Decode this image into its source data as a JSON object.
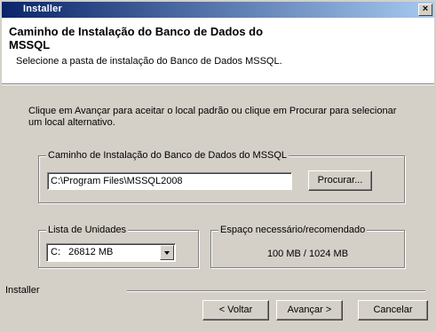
{
  "window": {
    "title": "Installer",
    "close_glyph": "×"
  },
  "header": {
    "title": "Caminho de Instalação do Banco de Dados do MSSQL",
    "subtitle": "Selecione a pasta de instalação do Banco de Dados MSSQL."
  },
  "instruction": "Clique em Avançar para aceitar o local padrão ou clique em Procurar para selecionar um local alternativo.",
  "path_group": {
    "label": "Caminho de Instalação do Banco de Dados do MSSQL",
    "value": "C:\\Program Files\\MSSQL2008",
    "browse_label": "Procurar..."
  },
  "drives_group": {
    "label": "Lista de Unidades",
    "selected": "C:   26812 MB"
  },
  "space_group": {
    "label": "Espaço necessário/recomendado",
    "value": "100 MB / 1024 MB"
  },
  "footer": {
    "label": "Installer",
    "back_label": "< Voltar",
    "next_label": "Avançar >",
    "cancel_label": "Cancelar"
  }
}
